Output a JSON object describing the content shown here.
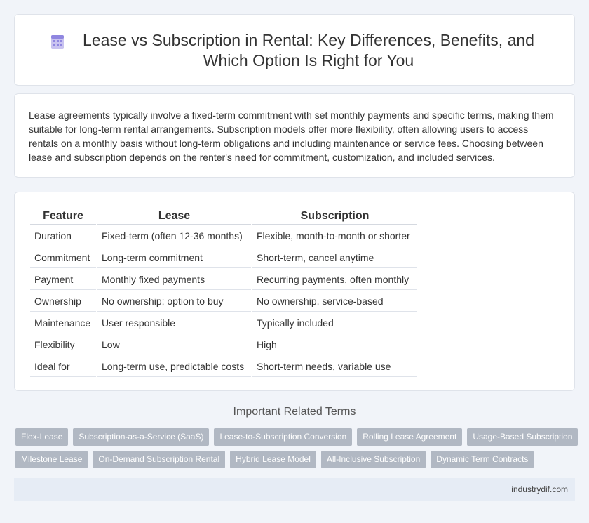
{
  "header": {
    "title": "Lease vs Subscription in Rental: Key Differences, Benefits, and Which Option Is Right for You",
    "icon": "building-icon"
  },
  "intro": {
    "text": "Lease agreements typically involve a fixed-term commitment with set monthly payments and specific terms, making them suitable for long-term rental arrangements. Subscription models offer more flexibility, often allowing users to access rentals on a monthly basis without long-term obligations and including maintenance or service fees. Choosing between lease and subscription depends on the renter's need for commitment, customization, and included services."
  },
  "table": {
    "headers": [
      "Feature",
      "Lease",
      "Subscription"
    ],
    "rows": [
      [
        "Duration",
        "Fixed-term (often 12-36 months)",
        "Flexible, month-to-month or shorter"
      ],
      [
        "Commitment",
        "Long-term commitment",
        "Short-term, cancel anytime"
      ],
      [
        "Payment",
        "Monthly fixed payments",
        "Recurring payments, often monthly"
      ],
      [
        "Ownership",
        "No ownership; option to buy",
        "No ownership, service-based"
      ],
      [
        "Maintenance",
        "User responsible",
        "Typically included"
      ],
      [
        "Flexibility",
        "Low",
        "High"
      ],
      [
        "Ideal for",
        "Long-term use, predictable costs",
        "Short-term needs, variable use"
      ]
    ]
  },
  "related": {
    "title": "Important Related Terms",
    "tags_row1": [
      "Flex-Lease",
      "Subscription-as-a-Service (SaaS)",
      "Lease-to-Subscription Conversion",
      "Rolling Lease Agreement",
      "Usage-Based Subscription"
    ],
    "tags_row2": [
      "Milestone Lease",
      "On-Demand Subscription Rental",
      "Hybrid Lease Model",
      "All-Inclusive Subscription",
      "Dynamic Term Contracts"
    ]
  },
  "footer": {
    "site": "industrydif.com"
  }
}
